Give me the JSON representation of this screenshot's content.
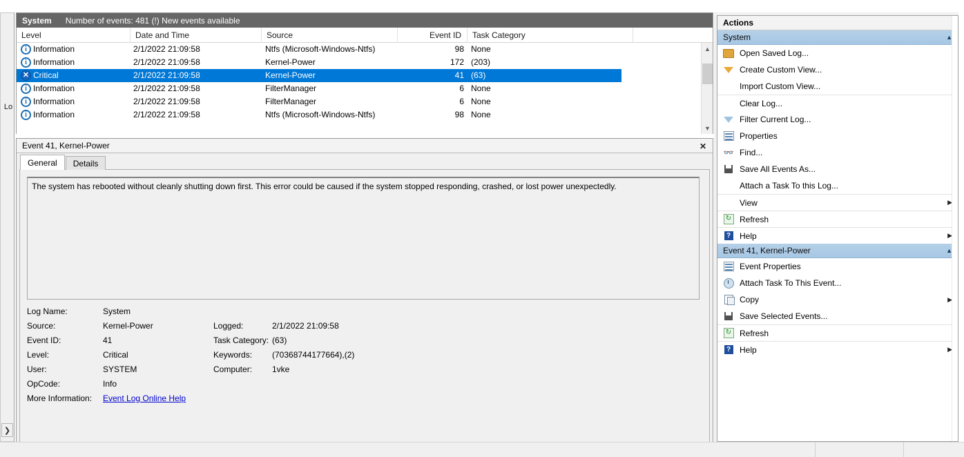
{
  "left_rail": {
    "label": "Lo",
    "expand_icon": "chevron-right-icon"
  },
  "event_list": {
    "title": "System",
    "info": "Number of events: 481 (!) New events available",
    "columns": [
      "Level",
      "Date and Time",
      "Source",
      "Event ID",
      "Task Category"
    ],
    "rows": [
      {
        "level": "Information",
        "icon": "information-icon",
        "date": "2/1/2022 21:09:58",
        "source": "Ntfs (Microsoft-Windows-Ntfs)",
        "event_id": "98",
        "task_category": "None",
        "selected": false
      },
      {
        "level": "Information",
        "icon": "information-icon",
        "date": "2/1/2022 21:09:58",
        "source": "Kernel-Power",
        "event_id": "172",
        "task_category": "(203)",
        "selected": false
      },
      {
        "level": "Critical",
        "icon": "critical-icon",
        "date": "2/1/2022 21:09:58",
        "source": "Kernel-Power",
        "event_id": "41",
        "task_category": "(63)",
        "selected": true
      },
      {
        "level": "Information",
        "icon": "information-icon",
        "date": "2/1/2022 21:09:58",
        "source": "FilterManager",
        "event_id": "6",
        "task_category": "None",
        "selected": false
      },
      {
        "level": "Information",
        "icon": "information-icon",
        "date": "2/1/2022 21:09:58",
        "source": "FilterManager",
        "event_id": "6",
        "task_category": "None",
        "selected": false
      },
      {
        "level": "Information",
        "icon": "information-icon",
        "date": "2/1/2022 21:09:58",
        "source": "Ntfs (Microsoft-Windows-Ntfs)",
        "event_id": "98",
        "task_category": "None",
        "selected": false
      }
    ],
    "scrollbar": {
      "up_icon": "chevron-up-icon",
      "down_icon": "chevron-down-icon"
    }
  },
  "detail": {
    "header": "Event 41, Kernel-Power",
    "close_icon": "close-icon",
    "tabs": [
      {
        "label": "General",
        "active": true
      },
      {
        "label": "Details",
        "active": false
      }
    ],
    "message": "The system has rebooted without cleanly shutting down first. This error could be caused if the system stopped responding, crashed, or lost power unexpectedly.",
    "fields": [
      {
        "label": "Log Name:",
        "value": "System",
        "label2": "",
        "value2": ""
      },
      {
        "label": "Source:",
        "value": "Kernel-Power",
        "label2": "Logged:",
        "value2": "2/1/2022 21:09:58"
      },
      {
        "label": "Event ID:",
        "value": "41",
        "label2": "Task Category:",
        "value2": "(63)"
      },
      {
        "label": "Level:",
        "value": "Critical",
        "label2": "Keywords:",
        "value2": "(70368744177664),(2)"
      },
      {
        "label": "User:",
        "value": "SYSTEM",
        "label2": "Computer:",
        "value2": "1vke"
      },
      {
        "label": "OpCode:",
        "value": "Info",
        "label2": "",
        "value2": ""
      }
    ],
    "more_info_label": "More Information:",
    "more_info_link": "Event Log Online Help"
  },
  "actions": {
    "title": "Actions",
    "groups": [
      {
        "header": "System",
        "chevron": "chevron-up-icon",
        "items": [
          {
            "label": "Open Saved Log...",
            "icon": "open-folder-icon",
            "submenu": false,
            "separator": false
          },
          {
            "label": "Create Custom View...",
            "icon": "funnel-icon",
            "submenu": false,
            "separator": false
          },
          {
            "label": "Import Custom View...",
            "icon": "none",
            "submenu": false,
            "separator": false
          },
          {
            "label": "Clear Log...",
            "icon": "none",
            "submenu": false,
            "separator": true
          },
          {
            "label": "Filter Current Log...",
            "icon": "funnel-blue-icon",
            "submenu": false,
            "separator": false
          },
          {
            "label": "Properties",
            "icon": "properties-icon",
            "submenu": false,
            "separator": false
          },
          {
            "label": "Find...",
            "icon": "binoculars-icon",
            "submenu": false,
            "separator": false
          },
          {
            "label": "Save All Events As...",
            "icon": "save-icon",
            "submenu": false,
            "separator": false
          },
          {
            "label": "Attach a Task To this Log...",
            "icon": "none",
            "submenu": false,
            "separator": false
          },
          {
            "label": "View",
            "icon": "none",
            "submenu": true,
            "separator": true
          },
          {
            "label": "Refresh",
            "icon": "refresh-icon",
            "submenu": false,
            "separator": true
          },
          {
            "label": "Help",
            "icon": "help-icon",
            "submenu": true,
            "separator": true
          }
        ]
      },
      {
        "header": "Event 41, Kernel-Power",
        "chevron": "chevron-up-icon",
        "items": [
          {
            "label": "Event Properties",
            "icon": "properties-icon",
            "submenu": false,
            "separator": false
          },
          {
            "label": "Attach Task To This Event...",
            "icon": "clock-task-icon",
            "submenu": false,
            "separator": false
          },
          {
            "label": "Copy",
            "icon": "copy-icon",
            "submenu": true,
            "separator": false
          },
          {
            "label": "Save Selected Events...",
            "icon": "save-icon",
            "submenu": false,
            "separator": false
          },
          {
            "label": "Refresh",
            "icon": "refresh-icon",
            "submenu": false,
            "separator": true
          },
          {
            "label": "Help",
            "icon": "help-icon",
            "submenu": true,
            "separator": true
          }
        ]
      }
    ]
  },
  "colors": {
    "selection_blue": "#0078d7",
    "title_gray": "#666666",
    "group_header_blue": "#a7c7e4",
    "link_blue": "#0000cc"
  }
}
